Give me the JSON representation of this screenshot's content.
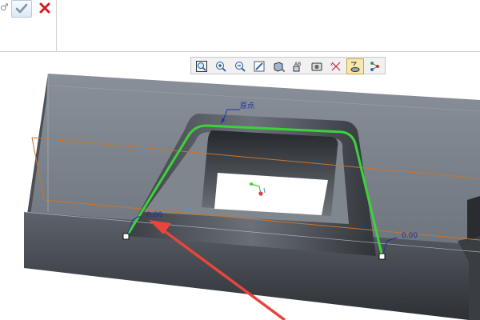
{
  "dashboard": {
    "gender_glyph": "♂",
    "ok_button": "confirm",
    "cancel_button": "cancel"
  },
  "view_toolbar": {
    "buttons": [
      {
        "name": "refit",
        "icon": "refit-icon"
      },
      {
        "name": "zoom-in",
        "icon": "zoom-in-icon"
      },
      {
        "name": "zoom-out",
        "icon": "zoom-out-icon"
      },
      {
        "name": "repaint",
        "icon": "repaint-icon"
      },
      {
        "name": "display-style",
        "icon": "display-style-icon"
      },
      {
        "name": "saved-orientations",
        "icon": "saved-orientations-icon"
      },
      {
        "name": "view-manager",
        "icon": "view-manager-icon"
      },
      {
        "name": "datum-display",
        "icon": "datum-display-icon"
      },
      {
        "name": "annotation-display",
        "icon": "annotation-display-icon"
      },
      {
        "name": "point-display",
        "icon": "point-display-icon"
      }
    ],
    "active_index": 8
  },
  "model": {
    "origin_label": "原点",
    "dimensions": [
      {
        "label": "0.00"
      },
      {
        "label": "0.00"
      }
    ]
  },
  "colors": {
    "trajectory": "#3bd23b",
    "dimension_text": "#1f2fa3",
    "arrow": "#e8453c",
    "datum_plane": "#c9742c",
    "part_face": "#79808a"
  }
}
